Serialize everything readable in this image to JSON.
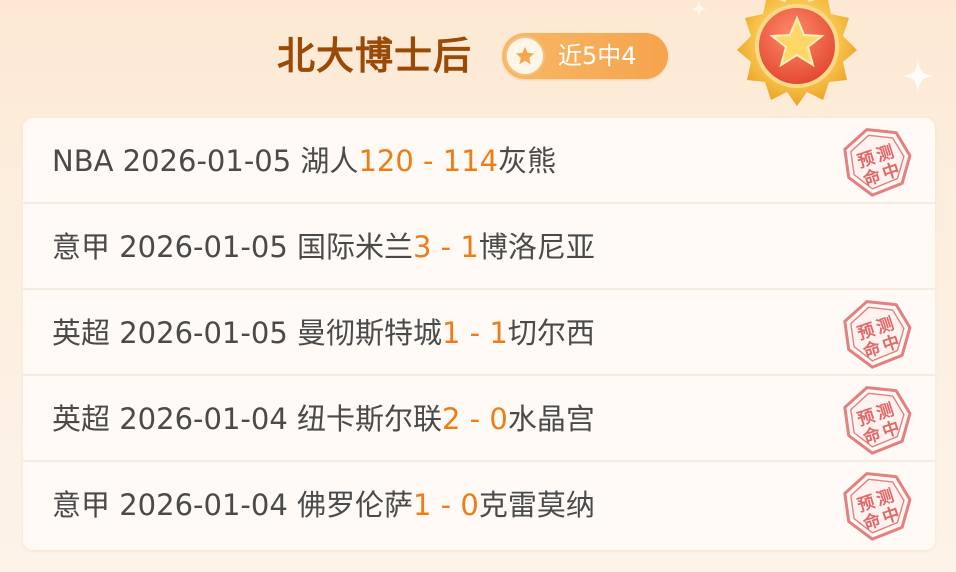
{
  "header": {
    "title": "北大博士后",
    "streak": "近5中4",
    "star_icon": "star-icon",
    "medal_icon": "star-medal-icon"
  },
  "stamp_text": "预测命中",
  "colors": {
    "title": "#9a4a06",
    "score": "#ee7d18",
    "text": "#4a4a4a",
    "stamp": "#e06a6a",
    "badge": "#f6a34d"
  },
  "matches": [
    {
      "league": "NBA",
      "date": "2026-01-05",
      "home": "湖人",
      "home_score": "120",
      "sep": " - ",
      "away_score": "114",
      "away": "灰熊",
      "hit": true
    },
    {
      "league": "意甲",
      "date": "2026-01-05",
      "home": "国际米兰",
      "home_score": "3",
      "sep": " - ",
      "away_score": "1",
      "away": "博洛尼亚",
      "hit": false
    },
    {
      "league": "英超",
      "date": "2026-01-05",
      "home": "曼彻斯特城",
      "home_score": "1",
      "sep": " - ",
      "away_score": "1",
      "away": "切尔西",
      "hit": true
    },
    {
      "league": "英超",
      "date": "2026-01-04",
      "home": "纽卡斯尔联",
      "home_score": "2",
      "sep": " - ",
      "away_score": "0",
      "away": "水晶宫",
      "hit": true
    },
    {
      "league": "意甲",
      "date": "2026-01-04",
      "home": "佛罗伦萨",
      "home_score": "1",
      "sep": " - ",
      "away_score": "0",
      "away": "克雷莫纳",
      "hit": true
    }
  ]
}
